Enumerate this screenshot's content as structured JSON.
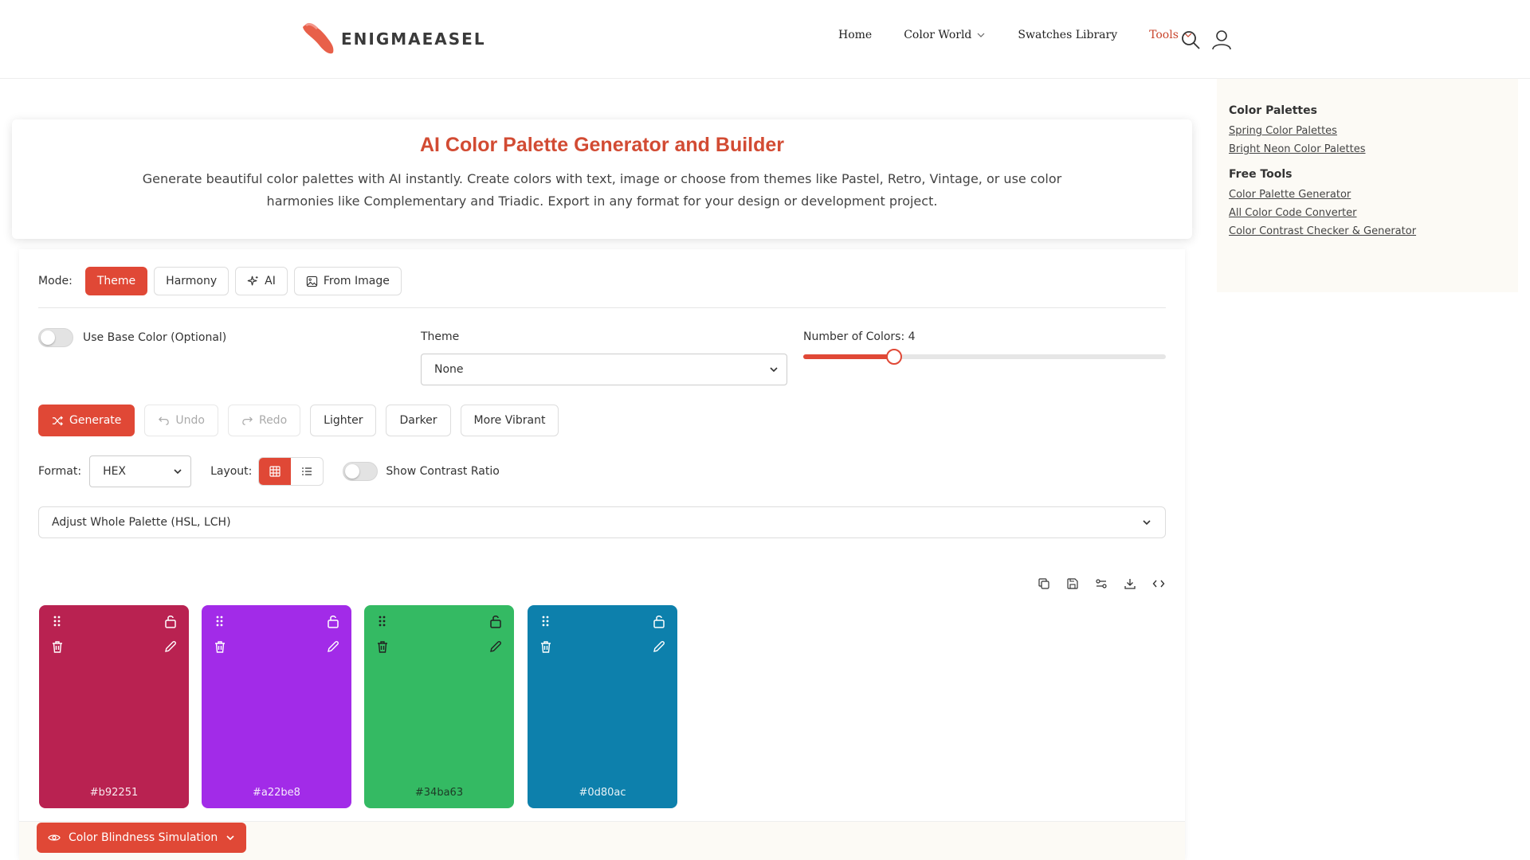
{
  "brand": {
    "name": "ENIGMAEASEL",
    "logo_color": "#e8604a"
  },
  "nav": {
    "items": [
      {
        "label": "Home",
        "has_dropdown": false,
        "active": false
      },
      {
        "label": "Color World",
        "has_dropdown": true,
        "active": false
      },
      {
        "label": "Swatches Library",
        "has_dropdown": false,
        "active": false
      },
      {
        "label": "Tools",
        "has_dropdown": true,
        "active": true
      }
    ],
    "icons": [
      "search-icon",
      "user-icon"
    ]
  },
  "intro": {
    "title": "AI Color Palette Generator and Builder",
    "description": "Generate beautiful color palettes with AI instantly. Create colors with text, image or choose from themes like Pastel, Retro, Vintage, or use color harmonies like Complementary and Triadic. Export in any format for your design or development project."
  },
  "mode": {
    "label": "Mode:",
    "options": [
      "Theme",
      "Harmony",
      "AI",
      "From Image"
    ],
    "selected": "Theme"
  },
  "base_color": {
    "label": "Use Base Color (Optional)",
    "enabled": false
  },
  "theme": {
    "label": "Theme",
    "value": "None"
  },
  "colors_count": {
    "label": "Number of Colors: 4",
    "value": 4,
    "min": 2,
    "max": 10
  },
  "actions": {
    "generate": "Generate",
    "undo": "Undo",
    "redo": "Redo",
    "lighter": "Lighter",
    "darker": "Darker",
    "more_vibrant": "More Vibrant"
  },
  "format": {
    "label": "Format:",
    "value": "HEX"
  },
  "layout": {
    "label": "Layout:",
    "selected": "grid"
  },
  "contrast": {
    "label": "Show Contrast Ratio",
    "enabled": false
  },
  "adjust": {
    "label": "Adjust Whole Palette (HSL, LCH)"
  },
  "toolbar_icons": [
    "copy-icon",
    "save-icon",
    "share-icon",
    "download-icon",
    "code-icon"
  ],
  "palette": [
    {
      "hex": "#b92251"
    },
    {
      "hex": "#a22be8"
    },
    {
      "hex": "#34ba63"
    },
    {
      "hex": "#0d80ac"
    }
  ],
  "color_blindness": {
    "label": "Color Blindness Simulation"
  },
  "sidebar": {
    "sections": [
      {
        "title": "Color Palettes",
        "links": [
          "Spring Color Palettes",
          "Bright Neon Color Palettes"
        ]
      },
      {
        "title": "Free Tools",
        "links": [
          "Color Palette Generator",
          "All Color Code Converter",
          "Color Contrast Checker & Generator"
        ]
      }
    ]
  },
  "accent_color": "#e04836"
}
